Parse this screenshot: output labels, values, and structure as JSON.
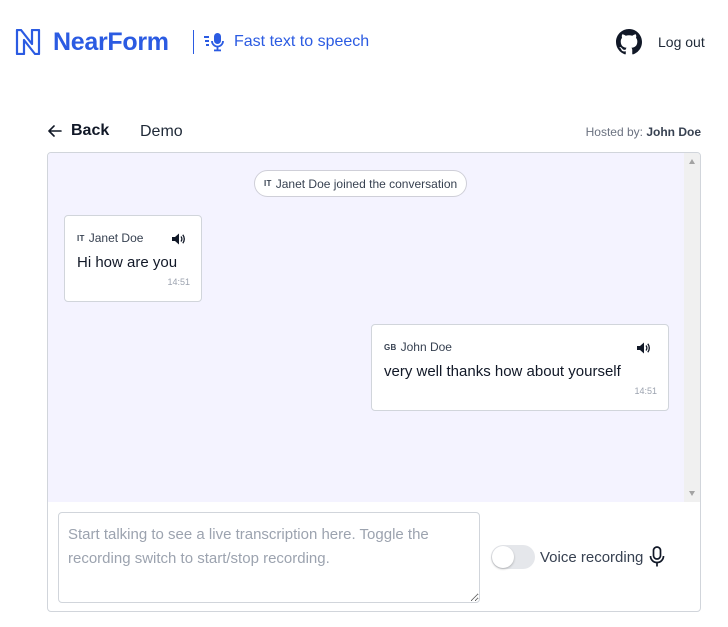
{
  "header": {
    "brand": "NearForm",
    "app_name": "Fast text to speech",
    "logout_label": "Log out",
    "icons": {
      "logo": "nearform-logo-icon",
      "app": "microphone-waves-icon",
      "github": "github-icon"
    },
    "brand_color": "#2b5be2"
  },
  "subnav": {
    "back_label": "Back",
    "room_name": "Demo",
    "hosted_prefix": "Hosted by:",
    "host_name": "John Doe"
  },
  "chat": {
    "background": "#f4f3ff",
    "join_notice": {
      "flag": "IT",
      "text": "Janet Doe joined the conversation"
    },
    "messages": [
      {
        "flag": "IT",
        "author": "Janet Doe",
        "text": "Hi how are you",
        "time": "14:51",
        "icon": "speaker-icon"
      },
      {
        "flag": "GB",
        "author": "John Doe",
        "text": "very well thanks how about yourself",
        "time": "14:51",
        "icon": "speaker-icon"
      }
    ]
  },
  "composer": {
    "placeholder": "Start talking to see a live transcription here. Toggle the recording switch to start/stop recording.",
    "value": "",
    "toggle_label": "Voice recording",
    "toggle_on": false,
    "mic_icon": "microphone-icon"
  }
}
